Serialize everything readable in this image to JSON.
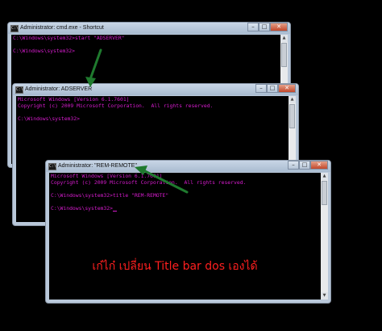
{
  "colors": {
    "console_text": "#d61ccd",
    "arrow": "#1f7a2e",
    "caption": "#ff1f1f"
  },
  "window1": {
    "title": "Administrator: cmd.exe - Shortcut",
    "controls": [
      "–",
      "□",
      "✕"
    ],
    "lines": [
      "C:\\Windows\\system32>start \"ADSERVER\"",
      "",
      "C:\\Windows\\system32>"
    ]
  },
  "window2": {
    "title": "Administrator: ADSERVER",
    "controls": [
      "–",
      "□",
      "✕"
    ],
    "lines": [
      "Microsoft Windows [Version 6.1.7601]",
      "Copyright (c) 2009 Microsoft Corporation.  All rights reserved.",
      "",
      "C:\\Windows\\system32>"
    ]
  },
  "window3": {
    "title": "Administrator:  \"REM-REMOTE\"",
    "controls": [
      "–",
      "□",
      "✕"
    ],
    "lines": [
      "Microsoft Windows [Version 6.1.7601]",
      "Copyright (c) 2009 Microsoft Corporation.  All rights reserved.",
      "",
      "C:\\Windows\\system32>title \"REM-REMOTE\"",
      "",
      "C:\\Windows\\system32>"
    ]
  },
  "caption": "เก๋ไก๋ เปลี่ยน Title bar dos เองได้"
}
